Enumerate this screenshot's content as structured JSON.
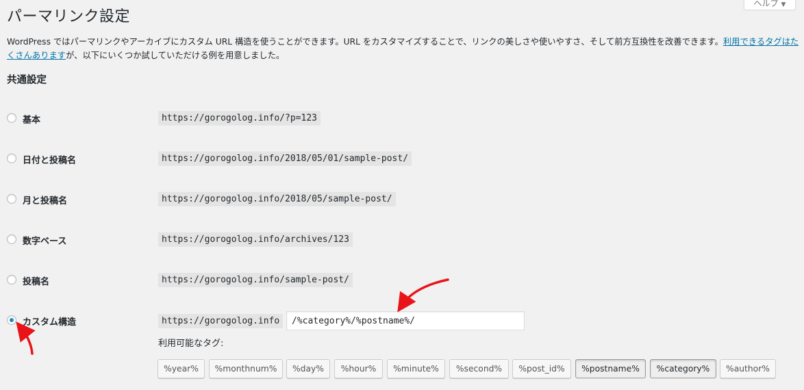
{
  "help": {
    "label": "ヘルプ",
    "arrow": "▼"
  },
  "page": {
    "title": "パーマリンク設定"
  },
  "intro": {
    "text_before": "WordPress ではパーマリンクやアーカイブにカスタム URL 構造を使うことができます。URL をカスタマイズすることで、リンクの美しさや使いやすさ、そして前方互換性を改善できます。",
    "link_text": "利用できるタグはたくさんあります",
    "text_after": "が、以下にいくつか試していただける例を用意しました。"
  },
  "section": {
    "title": "共通設定"
  },
  "options": [
    {
      "label": "基本",
      "url": "https://gorogolog.info/?p=123",
      "checked": false
    },
    {
      "label": "日付と投稿名",
      "url": "https://gorogolog.info/2018/05/01/sample-post/",
      "checked": false
    },
    {
      "label": "月と投稿名",
      "url": "https://gorogolog.info/2018/05/sample-post/",
      "checked": false
    },
    {
      "label": "数字ベース",
      "url": "https://gorogolog.info/archives/123",
      "checked": false
    },
    {
      "label": "投稿名",
      "url": "https://gorogolog.info/sample-post/",
      "checked": false
    },
    {
      "label": "カスタム構造",
      "url": "https://gorogolog.info",
      "checked": true
    }
  ],
  "custom": {
    "value": "/%category%/%postname%/"
  },
  "tags_label": "利用可能なタグ:",
  "tags": [
    {
      "label": "%year%",
      "active": false
    },
    {
      "label": "%monthnum%",
      "active": false
    },
    {
      "label": "%day%",
      "active": false
    },
    {
      "label": "%hour%",
      "active": false
    },
    {
      "label": "%minute%",
      "active": false
    },
    {
      "label": "%second%",
      "active": false
    },
    {
      "label": "%post_id%",
      "active": false
    },
    {
      "label": "%postname%",
      "active": true
    },
    {
      "label": "%category%",
      "active": true
    },
    {
      "label": "%author%",
      "active": false
    }
  ],
  "colors": {
    "accent": "#0073aa",
    "radio_checked": "#1e8cbe",
    "annotation": "#e8141a"
  }
}
